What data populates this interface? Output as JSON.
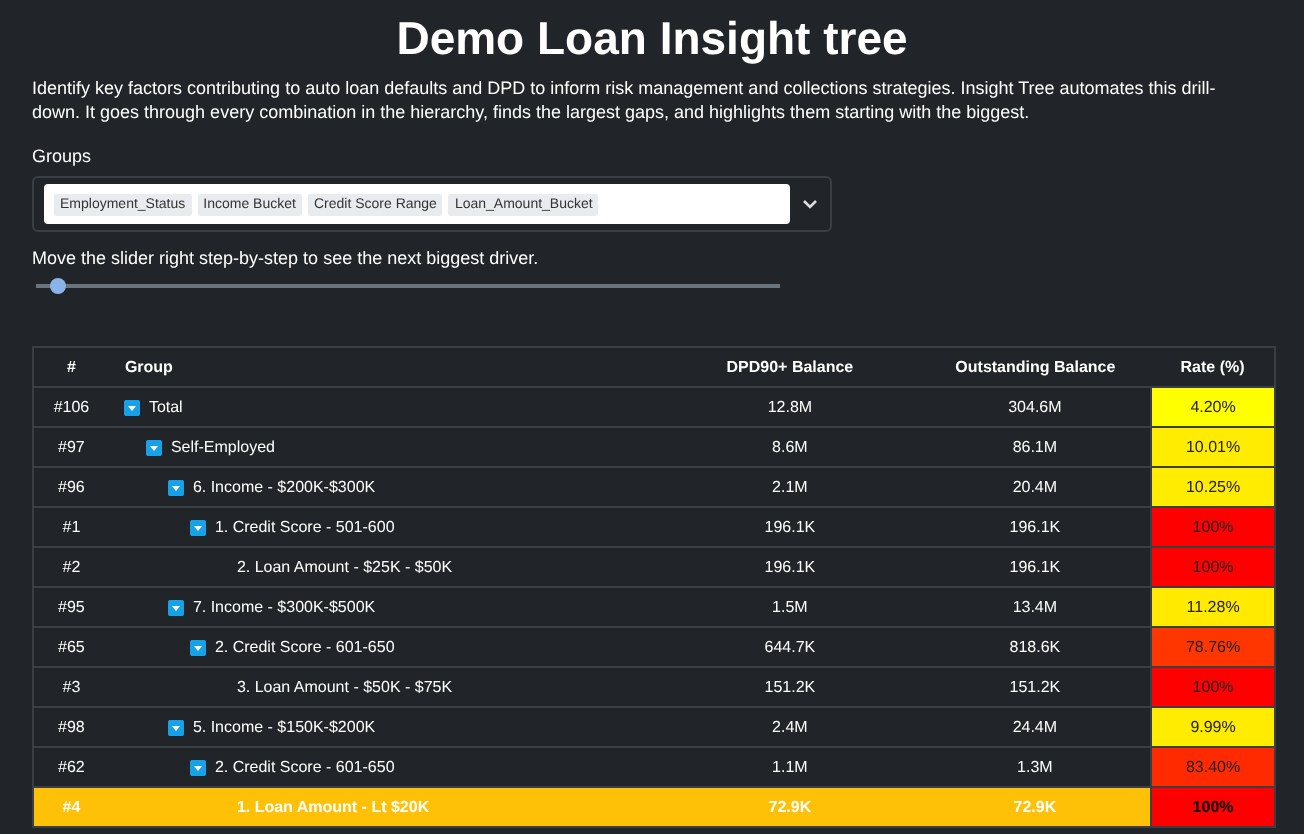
{
  "title": "Demo Loan Insight tree",
  "description": "Identify key factors contributing to auto loan defaults and DPD to inform risk management and collections strategies. Insight Tree automates this drill-down. It goes through every combination in the hierarchy, finds the largest gaps, and highlights them starting with the biggest.",
  "groups": {
    "label": "Groups",
    "tags": [
      "Employment_Status",
      "Income Bucket",
      "Credit Score Range",
      "Loan_Amount_Bucket"
    ]
  },
  "slider": {
    "label": "Move the slider right step-by-step to see the next biggest driver.",
    "level": 0.02
  },
  "table": {
    "columns": [
      "#",
      "Group",
      "DPD90+ Balance",
      "Outstanding Balance",
      "Rate (%)"
    ],
    "rows": [
      {
        "id": "#106",
        "group": "Total",
        "dpd": "12.8M",
        "outstanding": "304.6M",
        "rate": "4.20%",
        "color": "#ffff00",
        "selected": false,
        "expanded": true,
        "children": [
          {
            "id": "#97",
            "group": "Self-Employed",
            "dpd": "8.6M",
            "outstanding": "86.1M",
            "rate": "10.01%",
            "color": "#ffec00",
            "selected": false,
            "expanded": true,
            "children": [
              {
                "id": "#96",
                "group": "6. Income - $200K-$300K",
                "dpd": "2.1M",
                "outstanding": "20.4M",
                "rate": "10.25%",
                "color": "#ffec00",
                "selected": false,
                "expanded": true,
                "children": [
                  {
                    "id": "#1",
                    "group": "1. Credit Score - 501-600",
                    "dpd": "196.1K",
                    "outstanding": "196.1K",
                    "rate": "100%",
                    "color": "#ff0000",
                    "selected": false,
                    "expanded": true,
                    "children": [
                      {
                        "id": "#2",
                        "group": "2. Loan Amount - $25K - $50K",
                        "dpd": "196.1K",
                        "outstanding": "196.1K",
                        "rate": "100%",
                        "color": "#ff0000",
                        "selected": false
                      }
                    ]
                  }
                ]
              },
              {
                "id": "#95",
                "group": "7. Income - $300K-$500K",
                "dpd": "1.5M",
                "outstanding": "13.4M",
                "rate": "11.28%",
                "color": "#ffea00",
                "selected": false,
                "expanded": true,
                "children": [
                  {
                    "id": "#65",
                    "group": "2. Credit Score - 601-650",
                    "dpd": "644.7K",
                    "outstanding": "818.6K",
                    "rate": "78.76%",
                    "color": "#ff3600",
                    "selected": false,
                    "expanded": true,
                    "children": [
                      {
                        "id": "#3",
                        "group": "3. Loan Amount - $50K - $75K",
                        "dpd": "151.2K",
                        "outstanding": "151.2K",
                        "rate": "100%",
                        "color": "#ff0000",
                        "selected": false
                      }
                    ]
                  }
                ]
              },
              {
                "id": "#98",
                "group": "5. Income - $150K-$200K",
                "dpd": "2.4M",
                "outstanding": "24.4M",
                "rate": "9.99%",
                "color": "#ffec00",
                "selected": false,
                "expanded": true,
                "children": [
                  {
                    "id": "#62",
                    "group": "2. Credit Score - 601-650",
                    "dpd": "1.1M",
                    "outstanding": "1.3M",
                    "rate": "83.40%",
                    "color": "#ff2a00",
                    "selected": false,
                    "expanded": true,
                    "children": [
                      {
                        "id": "#4",
                        "group": "1. Loan Amount - Lt $20K",
                        "dpd": "72.9K",
                        "outstanding": "72.9K",
                        "rate": "100%",
                        "color": "#ff0000",
                        "selected": true
                      }
                    ]
                  }
                ]
              }
            ]
          }
        ]
      }
    ]
  }
}
